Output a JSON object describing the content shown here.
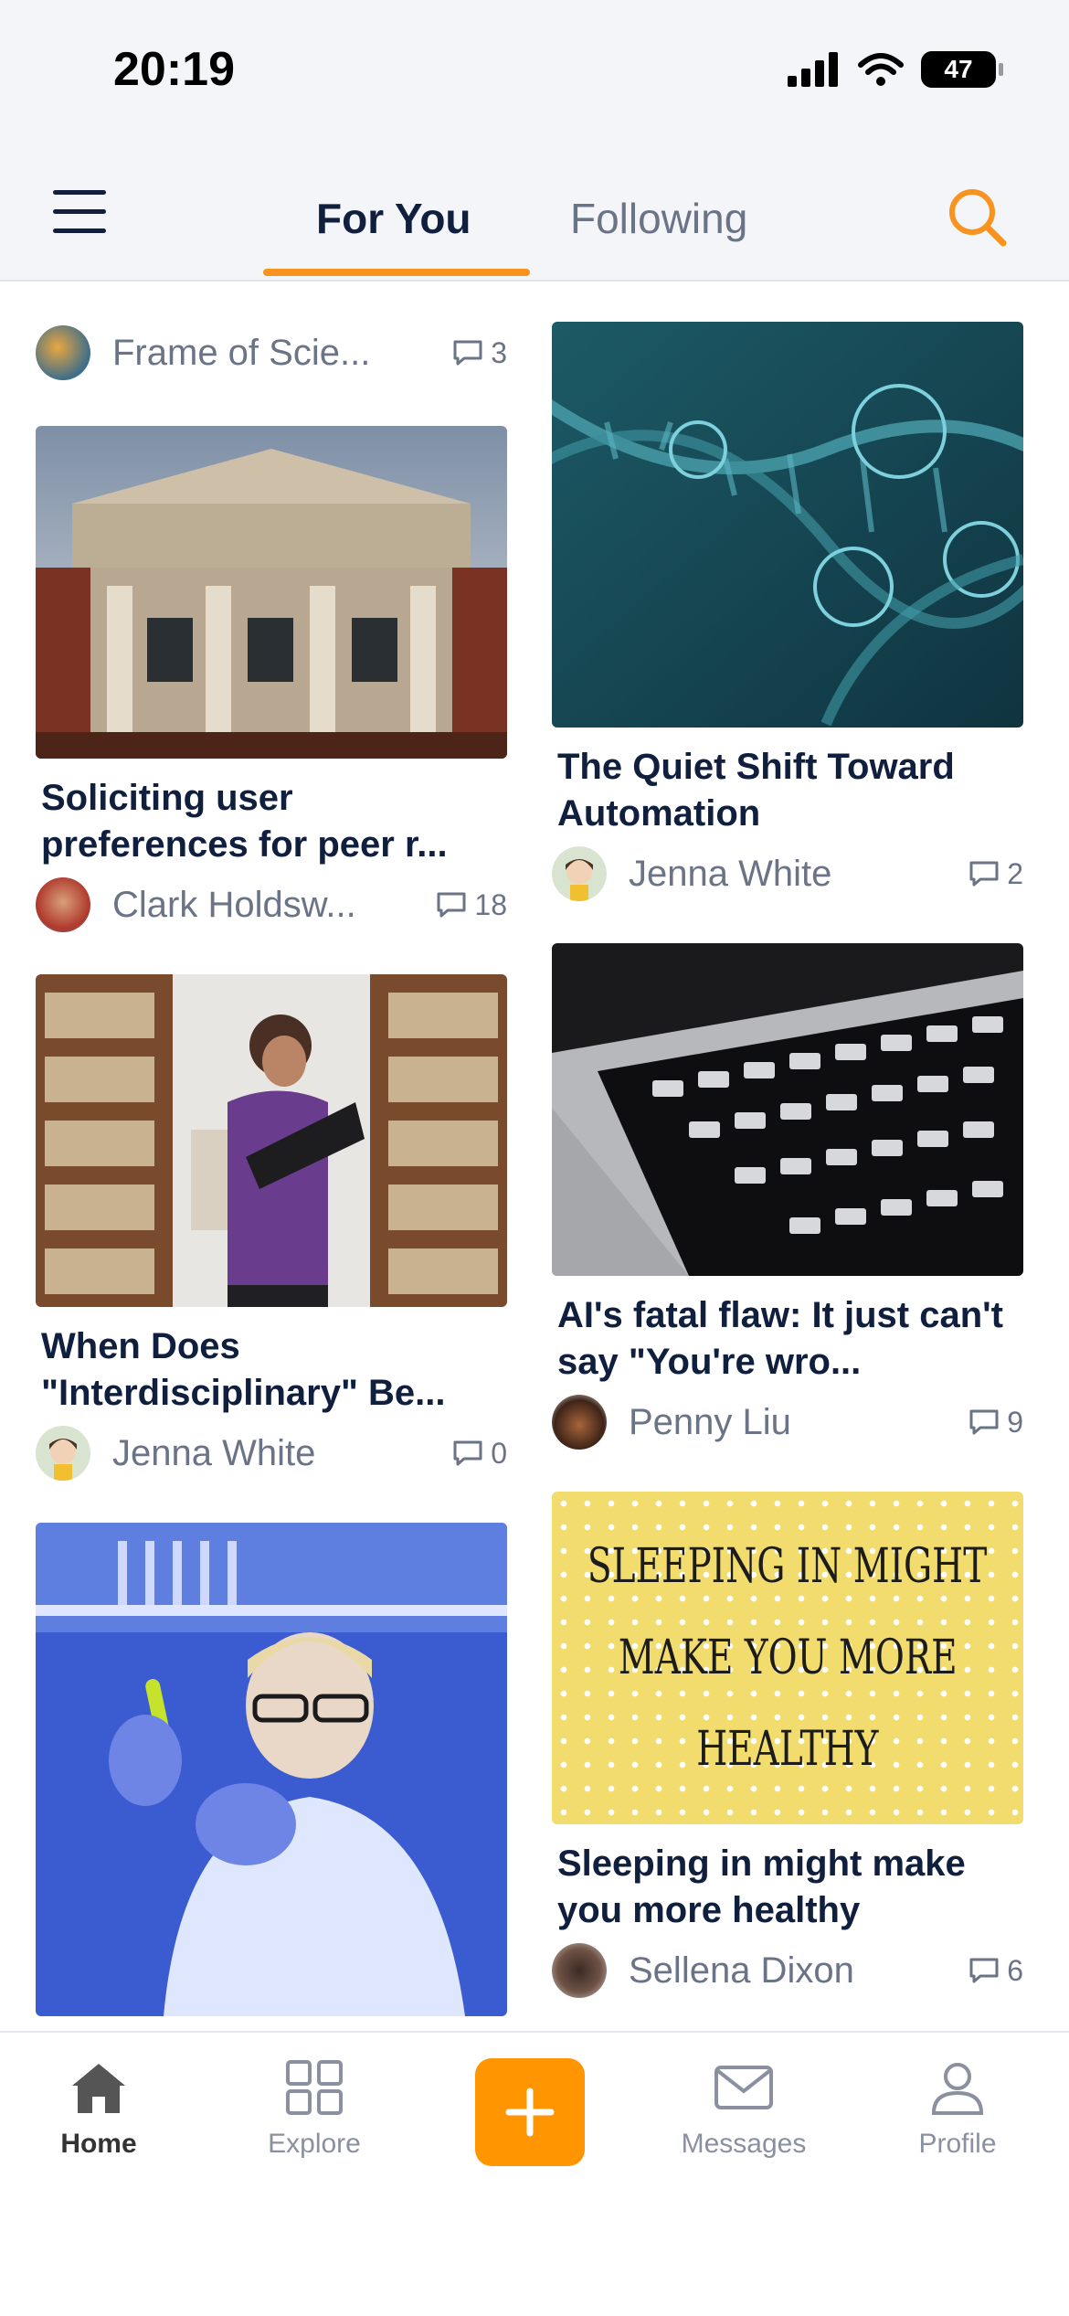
{
  "status_bar": {
    "time": "20:19",
    "battery": "47"
  },
  "header": {
    "tabs": [
      {
        "label": "For You",
        "active": true
      },
      {
        "label": "Following",
        "active": false
      }
    ]
  },
  "feed": {
    "left": {
      "top_source": {
        "name": "Frame of Scie...",
        "comments": "3"
      },
      "cards": [
        {
          "title": "Soliciting user preferences for peer r...",
          "author": "Clark Holdsw...",
          "comments": "18"
        },
        {
          "title": "When Does \"Interdisciplinary\" Be...",
          "author": "Jenna White",
          "comments": "0"
        }
      ]
    },
    "right": {
      "cards": [
        {
          "title": "The Quiet Shift Toward Automation",
          "author": "Jenna White",
          "comments": "2"
        },
        {
          "title": "AI's fatal flaw: It just can't say \"You're wro...",
          "author": "Penny Liu",
          "comments": "9"
        },
        {
          "image_text": [
            "Sleeping in might",
            "make you more",
            "healthy"
          ],
          "title": "Sleeping in might make you more healthy",
          "author": "Sellena Dixon",
          "comments": "6"
        }
      ]
    }
  },
  "bottom_nav": {
    "items": [
      {
        "label": "Home",
        "icon": "home-icon",
        "active": true
      },
      {
        "label": "Explore",
        "icon": "grid-icon",
        "active": false
      },
      {
        "label": "Messages",
        "icon": "mail-icon",
        "active": false
      },
      {
        "label": "Profile",
        "icon": "person-icon",
        "active": false
      }
    ]
  },
  "colors": {
    "accent": "#f7931e",
    "plus_button": "#ff9500",
    "title_text": "#0f1f3d",
    "muted_text": "#6b7386"
  }
}
